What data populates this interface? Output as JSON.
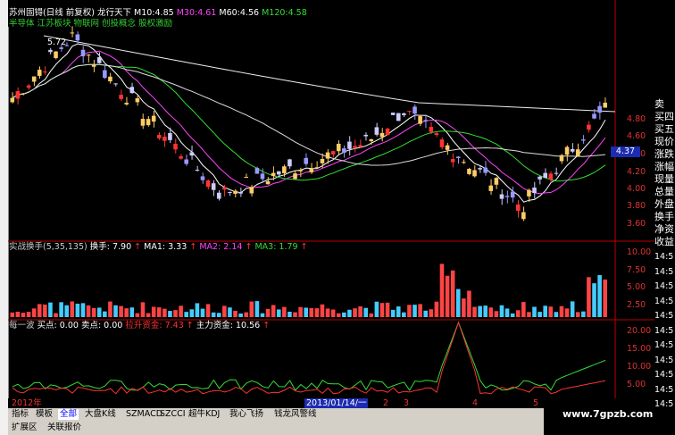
{
  "header": {
    "stock_name": "苏州固锝(日线 前复权)",
    "indicator_name": "龙行天下",
    "ma": [
      {
        "label": "M10:",
        "value": "4.85",
        "color": "#ffffff"
      },
      {
        "label": "M30:",
        "value": "4.61",
        "color": "#ff44ff"
      },
      {
        "label": "M60:",
        "value": "4.56",
        "color": "#ffffff"
      },
      {
        "label": "M120:",
        "value": "4.58",
        "color": "#33dd33"
      }
    ],
    "concepts": "半导体 江苏板块 物联网 创投概念 股权激励"
  },
  "price_panel": {
    "high_label": "5.72",
    "current_price": "4.37",
    "ticks": [
      "4.80",
      "4.60",
      "4.40",
      "4.20",
      "4.00",
      "3.80",
      "3.60"
    ]
  },
  "right_panel": {
    "items": [
      "卖",
      "买四",
      "买五",
      "现价",
      "涨跌",
      "涨幅",
      "现量",
      "总量",
      "外盘",
      "换手",
      "净资",
      "收益"
    ]
  },
  "volume_panel": {
    "label": "实战换手(5,35,135)",
    "turnover_label": "换手: 7.90",
    "ma1": "MA1: 3.33",
    "ma2": "MA2: 2.14",
    "ma3": "MA3: 1.79",
    "ticks": [
      "10.00",
      "7.50",
      "5.00",
      "2.50"
    ]
  },
  "indicator_panel": {
    "name": "每一波",
    "buy": "买点: 0.00",
    "sell": "卖点: 0.00",
    "lift": "拉升资金: 7.43",
    "main": "主力资金: 10.56",
    "ticks": [
      "20.00",
      "15.00",
      "10.00",
      "5.00"
    ]
  },
  "time_ticks": [
    "14:5",
    "14:5",
    "14:5",
    "14:5",
    "14:5",
    "14:5",
    "14:5",
    "14:5",
    "14:5",
    "14:5",
    "14:5"
  ],
  "date_axis": {
    "year_label": "2012年",
    "cursor_date": "2013/01/14/一",
    "month_labels": [
      "2",
      "3",
      "4",
      "5"
    ]
  },
  "tabs": [
    "指标",
    "模板",
    "全部",
    "大盘K线",
    "SZMACD",
    "SZCCI",
    "超牛KDJ",
    "我心飞扬",
    "钱龙风警线"
  ],
  "tabs2": [
    "扩展区",
    "关联报价"
  ],
  "watermark": "www.7gpzb.com"
}
